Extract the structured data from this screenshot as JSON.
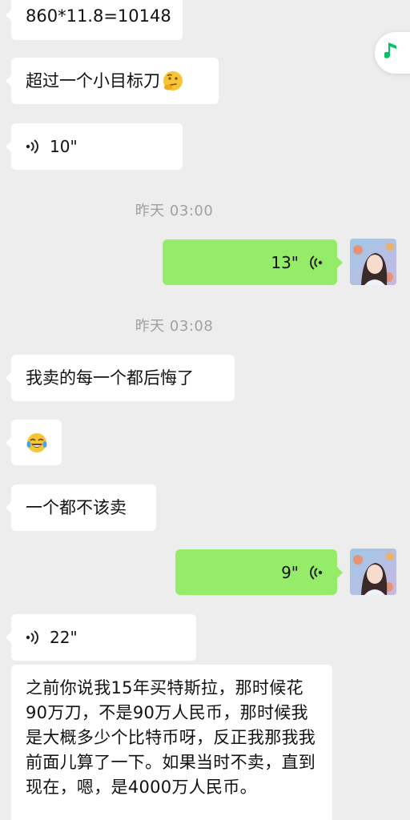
{
  "messages": {
    "m1": "860*11.8=10148",
    "m2": "超过一个小目标刀",
    "m3_duration": "10\"",
    "ts1": "昨天 03:00",
    "m4_duration": "13\"",
    "ts2": "昨天 03:08",
    "m5": "我卖的每一个都后悔了",
    "m6_emoji": "😂",
    "m7": "一个都不该卖",
    "m8_duration": "9\"",
    "m9_duration": "22\"",
    "m10": "之前你说我15年买特斯拉，那时候花90万刀，不是90万人民币，那时候我是大概多少个比特币呀，反正我那我我前面儿算了一下。如果当时不卖，直到现在，嗯，是4000万人民币。"
  },
  "icons": {
    "music": "music-note-icon",
    "voice": "voice-wave-icon",
    "thinking": "thinking-face-emoji"
  },
  "colors": {
    "background": "#ededed",
    "incoming_bubble": "#ffffff",
    "outgoing_bubble": "#95ec69",
    "timestamp": "#a0a0a0",
    "music_accent": "#07c160"
  }
}
